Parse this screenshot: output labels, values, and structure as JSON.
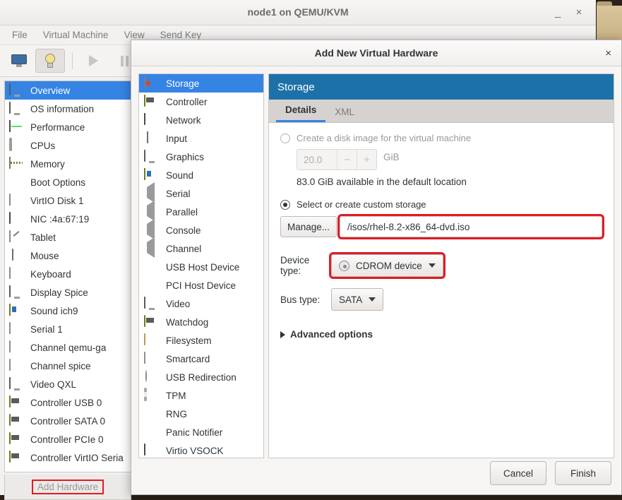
{
  "vm_window": {
    "title": "node1 on QEMU/KVM",
    "minimize_label": "_",
    "close_label": "×",
    "menus": [
      "File",
      "Virtual Machine",
      "View",
      "Send Key"
    ],
    "toolbar": [
      {
        "name": "console-view-button",
        "icon": "monitor-icon"
      },
      {
        "name": "details-view-button",
        "icon": "lightbulb-icon"
      },
      {
        "name": "run-button",
        "icon": "play-icon"
      },
      {
        "name": "pause-button",
        "icon": "pause-icon"
      }
    ],
    "hardware_items": [
      {
        "label": "Overview",
        "icon": "monitor-icon",
        "selected": true
      },
      {
        "label": "OS information",
        "icon": "monitor-icon",
        "selected": false
      },
      {
        "label": "Performance",
        "icon": "performance-graph-icon",
        "selected": false
      },
      {
        "label": "CPUs",
        "icon": "cpu-chip-icon",
        "selected": false
      },
      {
        "label": "Memory",
        "icon": "memory-stick-icon",
        "selected": false
      },
      {
        "label": "Boot Options",
        "icon": "gears-icon",
        "selected": false
      },
      {
        "label": "VirtIO Disk 1",
        "icon": "disk-icon",
        "selected": false
      },
      {
        "label": "NIC :4a:67:19",
        "icon": "network-icon",
        "selected": false
      },
      {
        "label": "Tablet",
        "icon": "tablet-icon",
        "selected": false
      },
      {
        "label": "Mouse",
        "icon": "mouse-icon",
        "selected": false
      },
      {
        "label": "Keyboard",
        "icon": "keyboard-icon",
        "selected": false
      },
      {
        "label": "Display Spice",
        "icon": "monitor-icon",
        "selected": false
      },
      {
        "label": "Sound ich9",
        "icon": "sound-card-icon",
        "selected": false
      },
      {
        "label": "Serial 1",
        "icon": "serial-icon",
        "selected": false
      },
      {
        "label": "Channel qemu-ga",
        "icon": "serial-icon",
        "selected": false
      },
      {
        "label": "Channel spice",
        "icon": "serial-icon",
        "selected": false
      },
      {
        "label": "Video QXL",
        "icon": "monitor-icon",
        "selected": false
      },
      {
        "label": "Controller USB 0",
        "icon": "controller-card-icon",
        "selected": false
      },
      {
        "label": "Controller SATA 0",
        "icon": "controller-card-icon",
        "selected": false
      },
      {
        "label": "Controller PCIe 0",
        "icon": "controller-card-icon",
        "selected": false
      },
      {
        "label": "Controller VirtIO Seria",
        "icon": "controller-card-icon",
        "selected": false
      }
    ],
    "add_hardware_label": "Add Hardware"
  },
  "dialog": {
    "title": "Add New Virtual Hardware",
    "close_label": "×",
    "hardware_types": [
      {
        "label": "Storage",
        "icon": "storage-icon",
        "selected": true
      },
      {
        "label": "Controller",
        "icon": "controller-card-icon",
        "selected": false
      },
      {
        "label": "Network",
        "icon": "network-icon",
        "selected": false
      },
      {
        "label": "Input",
        "icon": "mouse-icon",
        "selected": false
      },
      {
        "label": "Graphics",
        "icon": "monitor-icon",
        "selected": false
      },
      {
        "label": "Sound",
        "icon": "sound-card-icon",
        "selected": false
      },
      {
        "label": "Serial",
        "icon": "speaker-port-icon",
        "selected": false
      },
      {
        "label": "Parallel",
        "icon": "speaker-port-icon",
        "selected": false
      },
      {
        "label": "Console",
        "icon": "speaker-port-icon",
        "selected": false
      },
      {
        "label": "Channel",
        "icon": "speaker-port-icon",
        "selected": false
      },
      {
        "label": "USB Host Device",
        "icon": "gears-icon",
        "selected": false
      },
      {
        "label": "PCI Host Device",
        "icon": "gears-icon",
        "selected": false
      },
      {
        "label": "Video",
        "icon": "monitor-icon",
        "selected": false
      },
      {
        "label": "Watchdog",
        "icon": "controller-card-icon",
        "selected": false
      },
      {
        "label": "Filesystem",
        "icon": "folder-icon",
        "selected": false
      },
      {
        "label": "Smartcard",
        "icon": "serial-icon",
        "selected": false
      },
      {
        "label": "USB Redirection",
        "icon": "usb-icon",
        "selected": false
      },
      {
        "label": "TPM",
        "icon": "tpm-chip-icon",
        "selected": false
      },
      {
        "label": "RNG",
        "icon": "gears-icon",
        "selected": false
      },
      {
        "label": "Panic Notifier",
        "icon": "gears-icon",
        "selected": false
      },
      {
        "label": "Virtio VSOCK",
        "icon": "network-icon",
        "selected": false
      }
    ],
    "panel": {
      "header": "Storage",
      "tabs": [
        {
          "label": "Details",
          "selected": true
        },
        {
          "label": "XML",
          "selected": false
        }
      ],
      "create_disk_label": "Create a disk image for the virtual machine",
      "create_disk_selected": false,
      "disk_size_value": "20.0",
      "spin_minus": "−",
      "spin_plus": "+",
      "disk_size_unit": "GiB",
      "available_text": "83.0 GiB available in the default location",
      "custom_storage_label": "Select or create custom storage",
      "custom_storage_selected": true,
      "manage_button": "Manage...",
      "storage_path": "/isos/rhel-8.2-x86_64-dvd.iso",
      "device_type_label": "Device type:",
      "device_type_value": "CDROM device",
      "bus_type_label": "Bus type:",
      "bus_type_value": "SATA",
      "advanced_options_label": "Advanced options"
    },
    "buttons": {
      "cancel": "Cancel",
      "finish": "Finish"
    }
  },
  "colors": {
    "header_blue": "#1c71a8",
    "selection_blue": "#3584e4",
    "highlight_red": "#e01b24"
  }
}
